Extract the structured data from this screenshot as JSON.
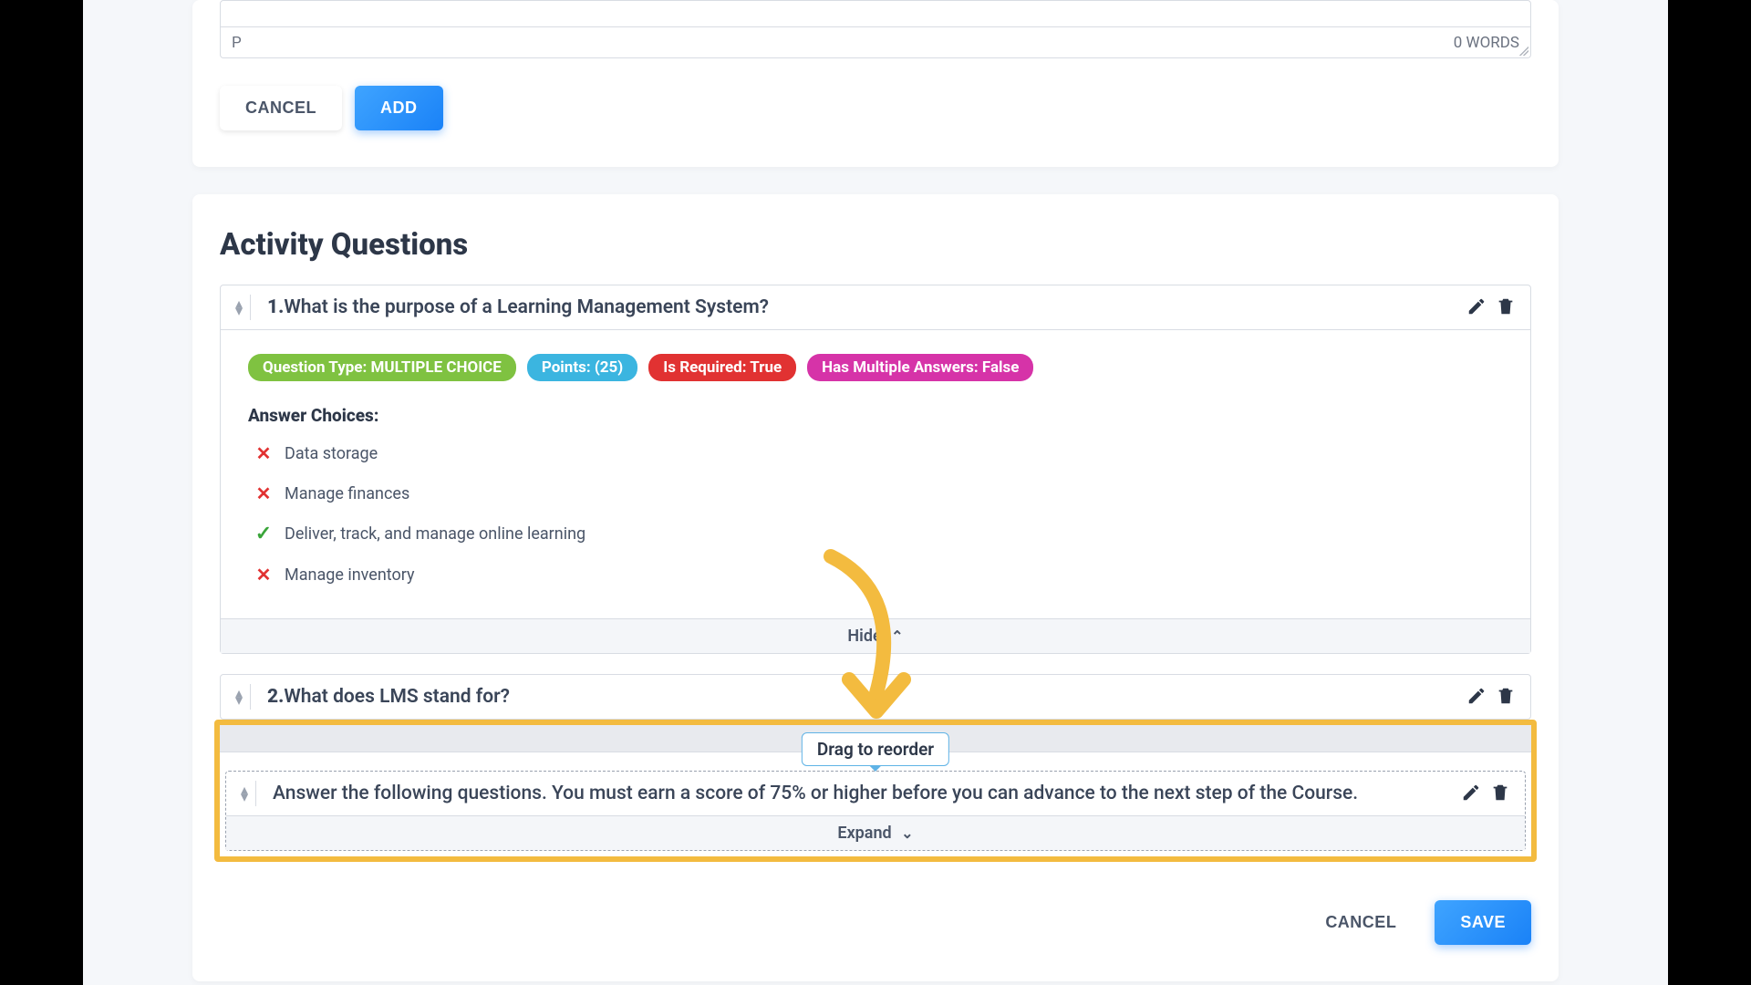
{
  "editor": {
    "path_indicator": "P",
    "word_count": "0 WORDS",
    "cancel": "CANCEL",
    "add": "ADD"
  },
  "section_title": "Activity Questions",
  "q1": {
    "number": "1.",
    "text": "What is the purpose of a Learning Management System?",
    "badge_type": "Question Type: MULTIPLE CHOICE",
    "badge_points": "Points: (25)",
    "badge_required": "Is Required: True",
    "badge_multi": "Has Multiple Answers: False",
    "choices_label": "Answer Choices:",
    "choices": [
      {
        "correct": false,
        "text": "Data storage"
      },
      {
        "correct": false,
        "text": "Manage finances"
      },
      {
        "correct": true,
        "text": "Deliver, track, and manage online learning"
      },
      {
        "correct": false,
        "text": "Manage inventory"
      }
    ],
    "hide": "Hide"
  },
  "q2": {
    "number": "2.",
    "text": "What does LMS stand for?"
  },
  "reorder_tooltip": "Drag to reorder",
  "drop_item": {
    "text": "Answer the following questions. You must earn a score of 75% or higher before you can advance to the next step of the Course.",
    "expand": "Expand"
  },
  "footer": {
    "cancel": "CANCEL",
    "save": "SAVE"
  }
}
